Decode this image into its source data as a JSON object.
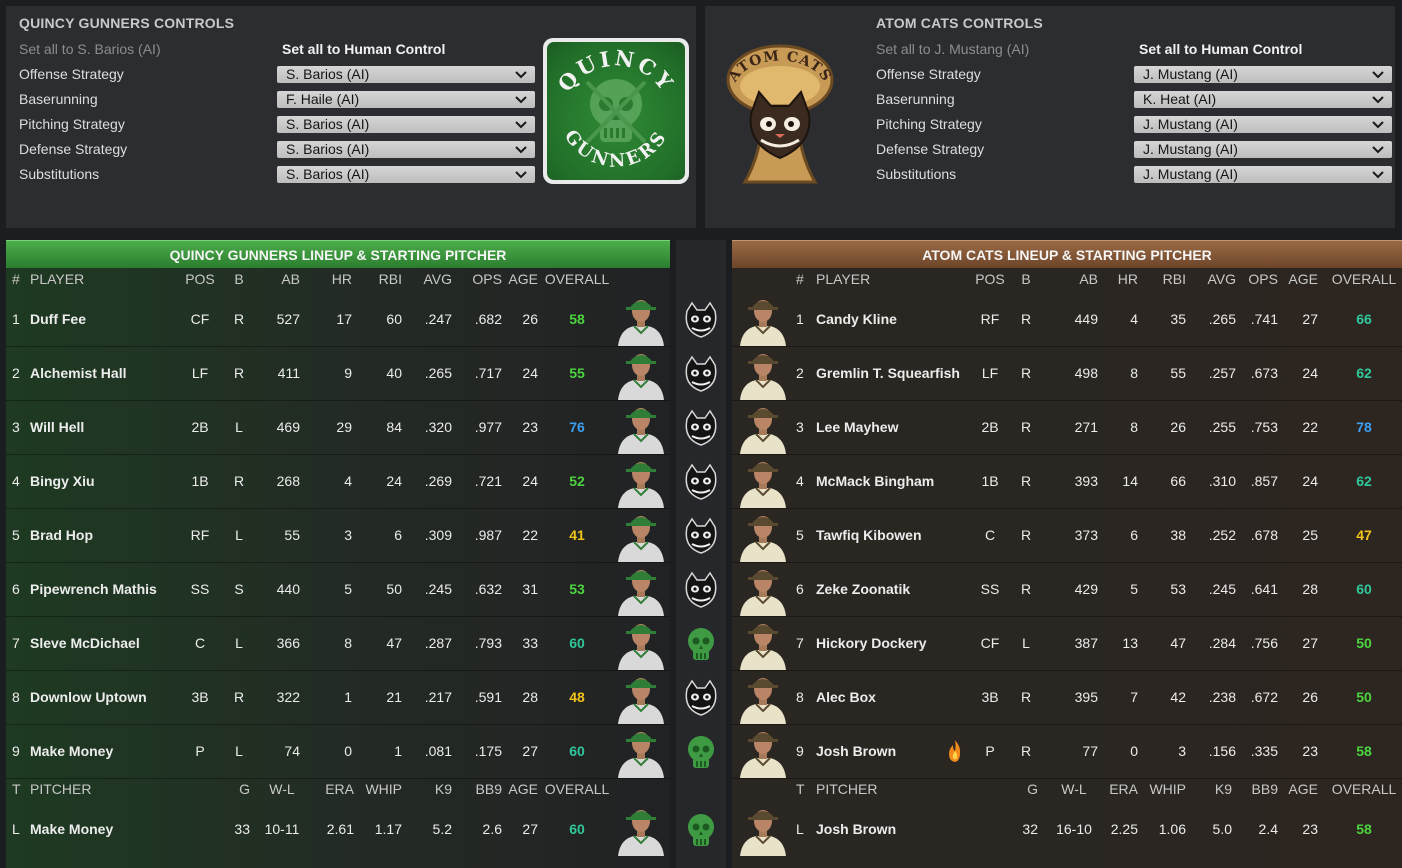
{
  "left_controls": {
    "title": "QUINCY GUNNERS CONTROLS",
    "set_all_ai": "Set all to S. Barios (AI)",
    "set_all_human": "Set all to Human Control",
    "rows": [
      {
        "label": "Offense Strategy",
        "value": "S. Barios (AI)"
      },
      {
        "label": "Baserunning",
        "value": "F. Haile (AI)"
      },
      {
        "label": "Pitching Strategy",
        "value": "S. Barios (AI)"
      },
      {
        "label": "Defense Strategy",
        "value": "S. Barios (AI)"
      },
      {
        "label": "Substitutions",
        "value": "S. Barios (AI)"
      }
    ],
    "logo": {
      "top_text": "QUINCY",
      "bottom_text": "GUNNERS"
    }
  },
  "right_controls": {
    "title": "ATOM CATS CONTROLS",
    "set_all_ai": "Set all to J. Mustang (AI)",
    "set_all_human": "Set all to Human Control",
    "rows": [
      {
        "label": "Offense Strategy",
        "value": "J. Mustang (AI)"
      },
      {
        "label": "Baserunning",
        "value": "K. Heat (AI)"
      },
      {
        "label": "Pitching Strategy",
        "value": "J. Mustang (AI)"
      },
      {
        "label": "Defense Strategy",
        "value": "J. Mustang (AI)"
      },
      {
        "label": "Substitutions",
        "value": "J. Mustang (AI)"
      }
    ],
    "logo": {
      "top_text": "ATOM CATS"
    }
  },
  "headers": {
    "batting": [
      "#",
      "PLAYER",
      "POS",
      "B",
      "AB",
      "HR",
      "RBI",
      "AVG",
      "OPS",
      "AGE",
      "OVERALL"
    ],
    "pitching": [
      "T",
      "PITCHER",
      "G",
      "W-L",
      "ERA",
      "WHIP",
      "K9",
      "BB9",
      "AGE",
      "OVERALL"
    ]
  },
  "left_lineup": {
    "title": "QUINCY GUNNERS LINEUP & STARTING PITCHER",
    "players": [
      {
        "num": "1",
        "name": "Duff Fee",
        "pos": "CF",
        "b": "R",
        "ab": "527",
        "hr": "17",
        "rbi": "60",
        "avg": ".247",
        "ops": ".682",
        "age": "26",
        "overall": "58",
        "tier": "green"
      },
      {
        "num": "2",
        "name": "Alchemist Hall",
        "pos": "LF",
        "b": "R",
        "ab": "411",
        "hr": "9",
        "rbi": "40",
        "avg": ".265",
        "ops": ".717",
        "age": "24",
        "overall": "55",
        "tier": "green"
      },
      {
        "num": "3",
        "name": "Will Hell",
        "pos": "2B",
        "b": "L",
        "ab": "469",
        "hr": "29",
        "rbi": "84",
        "avg": ".320",
        "ops": ".977",
        "age": "23",
        "overall": "76",
        "tier": "blue"
      },
      {
        "num": "4",
        "name": "Bingy Xiu",
        "pos": "1B",
        "b": "R",
        "ab": "268",
        "hr": "4",
        "rbi": "24",
        "avg": ".269",
        "ops": ".721",
        "age": "24",
        "overall": "52",
        "tier": "green"
      },
      {
        "num": "5",
        "name": "Brad Hop",
        "pos": "RF",
        "b": "L",
        "ab": "55",
        "hr": "3",
        "rbi": "6",
        "avg": ".309",
        "ops": ".987",
        "age": "22",
        "overall": "41",
        "tier": "yellow"
      },
      {
        "num": "6",
        "name": "Pipewrench Mathis",
        "pos": "SS",
        "b": "S",
        "ab": "440",
        "hr": "5",
        "rbi": "50",
        "avg": ".245",
        "ops": ".632",
        "age": "31",
        "overall": "53",
        "tier": "green"
      },
      {
        "num": "7",
        "name": "Sleve McDichael",
        "pos": "C",
        "b": "L",
        "ab": "366",
        "hr": "8",
        "rbi": "47",
        "avg": ".287",
        "ops": ".793",
        "age": "33",
        "overall": "60",
        "tier": "teal"
      },
      {
        "num": "8",
        "name": "Downlow Uptown",
        "pos": "3B",
        "b": "R",
        "ab": "322",
        "hr": "1",
        "rbi": "21",
        "avg": ".217",
        "ops": ".591",
        "age": "28",
        "overall": "48",
        "tier": "yellow"
      },
      {
        "num": "9",
        "name": "Make Money",
        "pos": "P",
        "b": "L",
        "ab": "74",
        "hr": "0",
        "rbi": "1",
        "avg": ".081",
        "ops": ".175",
        "age": "27",
        "overall": "60",
        "tier": "teal"
      }
    ],
    "pitcher": {
      "t": "L",
      "name": "Make Money",
      "g": "33",
      "wl": "10-11",
      "era": "2.61",
      "whip": "1.17",
      "k9": "5.2",
      "bb9": "2.6",
      "age": "27",
      "overall": "60",
      "tier": "teal"
    }
  },
  "right_lineup": {
    "title": "ATOM CATS LINEUP & STARTING PITCHER",
    "players": [
      {
        "num": "1",
        "name": "Candy Kline",
        "pos": "RF",
        "b": "R",
        "ab": "449",
        "hr": "4",
        "rbi": "35",
        "avg": ".265",
        "ops": ".741",
        "age": "27",
        "overall": "66",
        "tier": "teal"
      },
      {
        "num": "2",
        "name": "Gremlin T. Squearfish",
        "pos": "LF",
        "b": "R",
        "ab": "498",
        "hr": "8",
        "rbi": "55",
        "avg": ".257",
        "ops": ".673",
        "age": "24",
        "overall": "62",
        "tier": "teal"
      },
      {
        "num": "3",
        "name": "Lee Mayhew",
        "pos": "2B",
        "b": "R",
        "ab": "271",
        "hr": "8",
        "rbi": "26",
        "avg": ".255",
        "ops": ".753",
        "age": "22",
        "overall": "78",
        "tier": "blue"
      },
      {
        "num": "4",
        "name": "McMack Bingham",
        "pos": "1B",
        "b": "R",
        "ab": "393",
        "hr": "14",
        "rbi": "66",
        "avg": ".310",
        "ops": ".857",
        "age": "24",
        "overall": "62",
        "tier": "teal"
      },
      {
        "num": "5",
        "name": "Tawfiq Kibowen",
        "pos": "C",
        "b": "R",
        "ab": "373",
        "hr": "6",
        "rbi": "38",
        "avg": ".252",
        "ops": ".678",
        "age": "25",
        "overall": "47",
        "tier": "yellow"
      },
      {
        "num": "6",
        "name": "Zeke Zoonatik",
        "pos": "SS",
        "b": "R",
        "ab": "429",
        "hr": "5",
        "rbi": "53",
        "avg": ".245",
        "ops": ".641",
        "age": "28",
        "overall": "60",
        "tier": "teal"
      },
      {
        "num": "7",
        "name": "Hickory Dockery",
        "pos": "CF",
        "b": "L",
        "ab": "387",
        "hr": "13",
        "rbi": "47",
        "avg": ".284",
        "ops": ".756",
        "age": "27",
        "overall": "50",
        "tier": "green"
      },
      {
        "num": "8",
        "name": "Alec Box",
        "pos": "3B",
        "b": "R",
        "ab": "395",
        "hr": "7",
        "rbi": "42",
        "avg": ".238",
        "ops": ".672",
        "age": "26",
        "overall": "50",
        "tier": "green"
      },
      {
        "num": "9",
        "name": "Josh Brown",
        "pos": "P",
        "b": "R",
        "ab": "77",
        "hr": "0",
        "rbi": "3",
        "avg": ".156",
        "ops": ".335",
        "age": "23",
        "overall": "58",
        "tier": "green",
        "hot": true
      }
    ],
    "pitcher": {
      "t": "L",
      "name": "Josh Brown",
      "g": "32",
      "wl": "16-10",
      "era": "2.25",
      "whip": "1.06",
      "k9": "5.0",
      "bb9": "2.4",
      "age": "23",
      "overall": "58",
      "tier": "green"
    }
  },
  "matchup_icons": [
    "cat-icon",
    "cat-icon",
    "cat-icon",
    "cat-icon",
    "cat-icon",
    "cat-icon",
    "skull-icon",
    "cat-icon",
    "skull-icon",
    "skull-icon"
  ],
  "colors": {
    "gunners_green": "#2b7d2f",
    "atom_brown": "#7a4e30",
    "rating_green": "#4cd43e",
    "rating_blue": "#3da0f0",
    "rating_teal": "#2fc79b",
    "rating_yellow": "#f2c318"
  }
}
